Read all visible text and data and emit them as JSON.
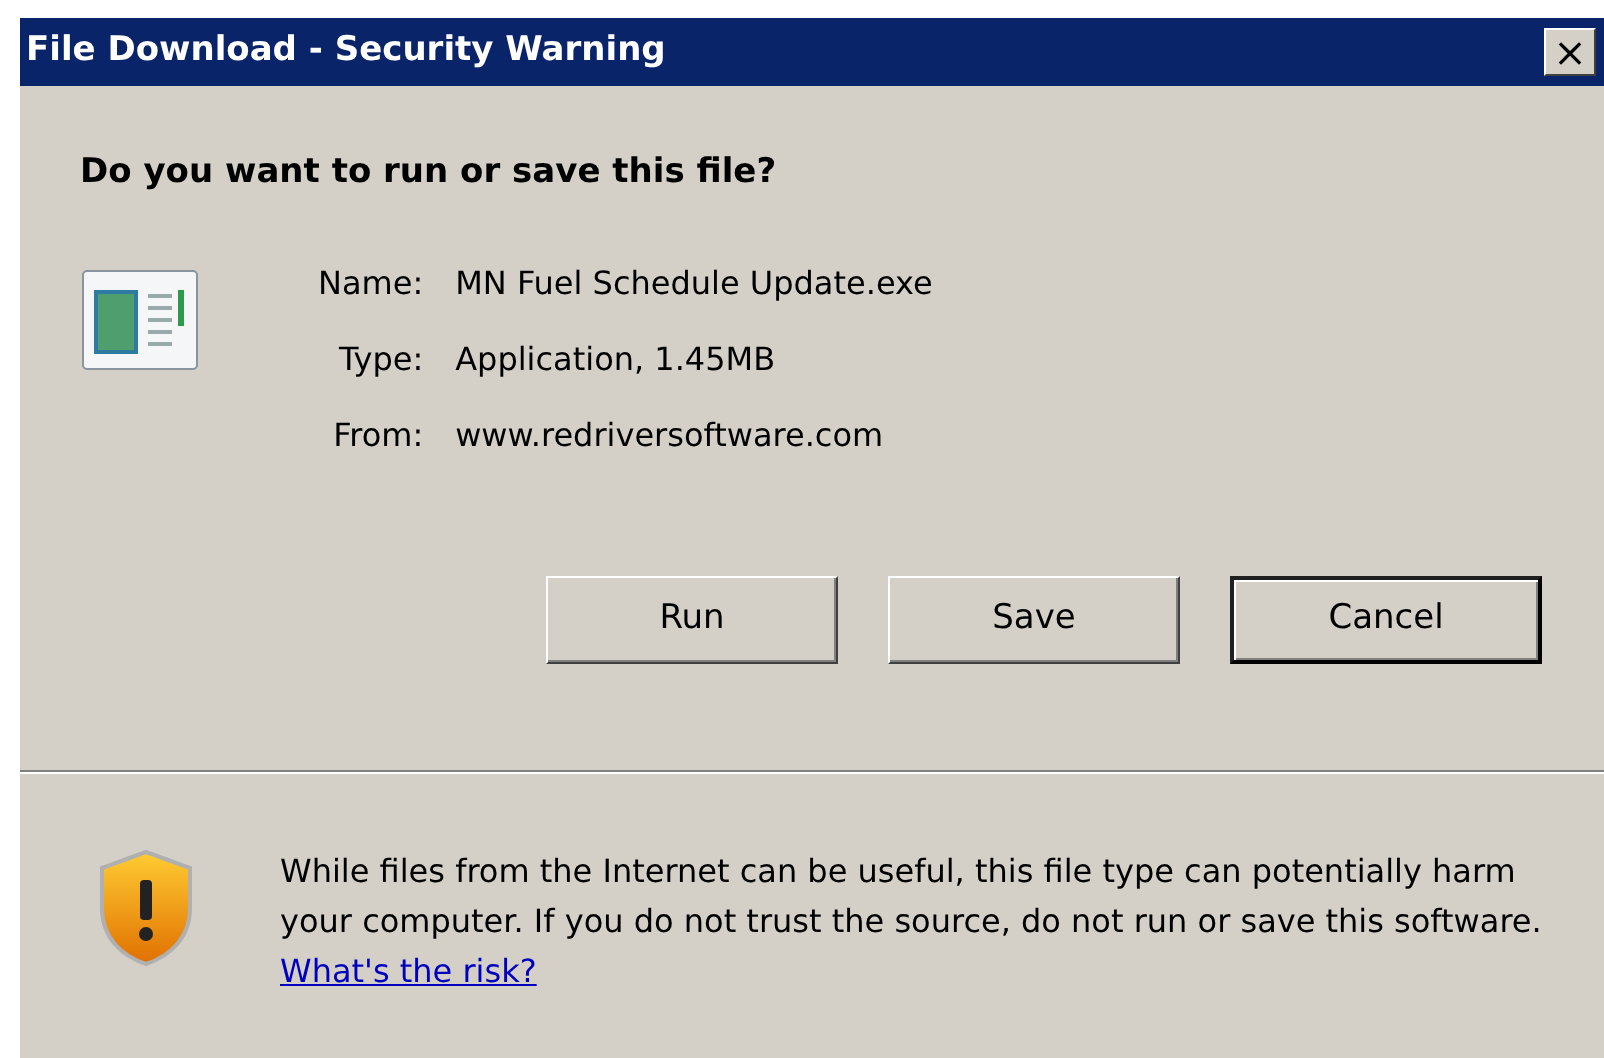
{
  "window": {
    "title": "File Download - Security Warning",
    "close": "×"
  },
  "question": "Do you want to run or save this file?",
  "details": [
    {
      "label": "Name:",
      "value": "MN Fuel Schedule Update.exe"
    },
    {
      "label": "Type:",
      "value": "Application, 1.45MB"
    },
    {
      "label": "From:",
      "value": "www.redriversoftware.com"
    }
  ],
  "buttons": [
    {
      "label": "Run",
      "default": false
    },
    {
      "label": "Save",
      "default": false
    },
    {
      "label": "Cancel",
      "default": true
    }
  ],
  "warning": {
    "text": "While files from the Internet can be useful, this file type can potentially harm your computer. If you do not trust the source, do not run or save this software.",
    "link": "What's the risk?"
  }
}
